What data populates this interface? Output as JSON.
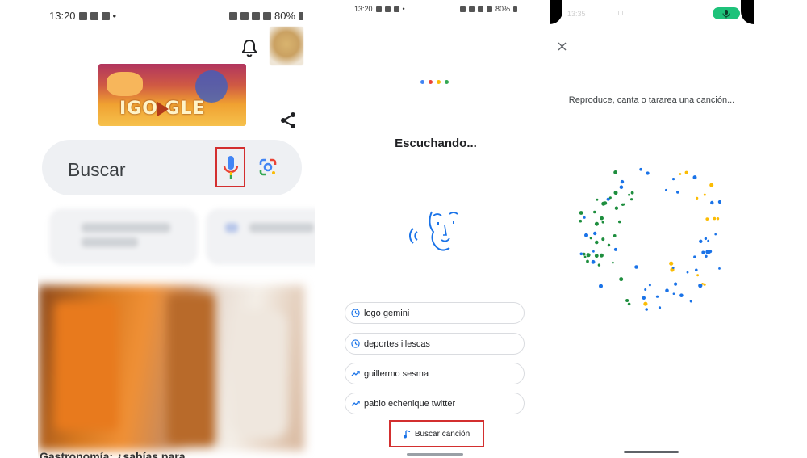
{
  "phone1": {
    "status_time": "13:20",
    "status_battery": "80%",
    "search_placeholder": "Buscar",
    "news_title": "Gastronomía: ¿sabías para"
  },
  "phone2": {
    "status_time": "13:20",
    "status_battery": "80%",
    "listening_title": "Escuchando...",
    "suggestions": [
      {
        "icon": "history-icon",
        "label": "logo gemini"
      },
      {
        "icon": "history-icon",
        "label": "deportes illescas"
      },
      {
        "icon": "trending-icon",
        "label": "guillermo sesma"
      },
      {
        "icon": "trending-icon",
        "label": "pablo echenique twitter"
      }
    ],
    "search_song_label": "Buscar canción"
  },
  "phone3": {
    "status_time": "13:35",
    "prompt": "Reproduce, canta o tararea una canción..."
  },
  "colors": {
    "google_blue": "#4285F4",
    "google_red": "#EA4335",
    "google_yellow": "#FBBC05",
    "google_green": "#34A853",
    "dot_blue": "#1a73e8",
    "dot_green": "#1e8e3e",
    "dot_yellow": "#fbbc04",
    "highlight_red": "#d32f2f",
    "mic_pill_green": "#1ec27a"
  }
}
